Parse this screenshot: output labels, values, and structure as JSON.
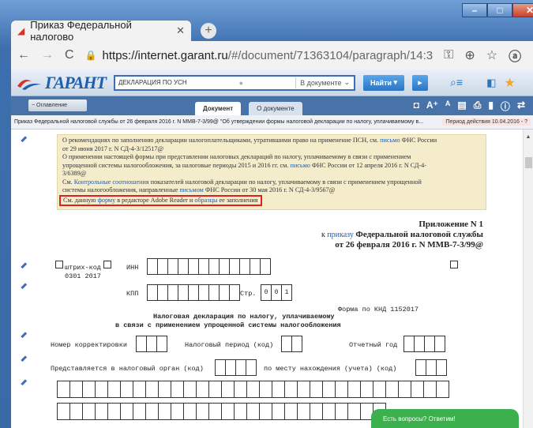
{
  "browser": {
    "tab_title": "Приказ Федеральной налогово",
    "url_host": "https://internet.garant.ru",
    "url_path": "/#/document/71363104/paragraph/14:3"
  },
  "garant": {
    "logo": "ГАРАНТ",
    "search_value": "ДЕКЛАРАЦИЯ ПО УСН",
    "search_scope": "В документе",
    "find_label": "Найти",
    "sidebar_label": "Оглавление",
    "tab_document": "Документ",
    "tab_about": "О документе"
  },
  "crumb": {
    "text": "Приказ Федеральной налоговой службы от 26 февраля 2016 г. N ММВ-7-3/99@ \"Об утверждении формы налоговой декларации по налогу, уплачиваемому в...",
    "period": "Период действия 10.04.2016 - ?"
  },
  "note": {
    "l1": "О рекомендациях по заполнению декларации налогоплательщиками, утратившими право на применение ПСН, см.",
    "l1_link": "письмо",
    "l1_end": "ФНС России",
    "l2": "от 29 июня 2017 г. N СД-4-3/12517@",
    "l3": "О применении настоящей формы при представлении налоговых деклараций по налогу, уплачиваемому в связи с применением",
    "l4a": "упрощенной системы налогообложения, за налоговые периоды 2015 и 2016 гг. см.",
    "l4_link": "письмо",
    "l4b": "ФНС России от 12 апреля 2016 г. N СД-4-",
    "l5": "3/6389@",
    "l6a": "См.",
    "l6_link": "Контрольные соотношения",
    "l6b": "показателей налоговой декларации по налогу, уплачиваемому в связи с применением упрощенной",
    "l7a": "системы налогообложения, направленные",
    "l7_link": "письмом",
    "l7b": "ФНС России от 30 мая 2016 г. N СД-4-3/9567@",
    "l8a": "См. данную",
    "l8_link1": "форму",
    "l8b": "в редакторе Adobe Reader и",
    "l8_link2": "образцы",
    "l8c": "ее заполнения"
  },
  "appendix": {
    "title": "Приложение N 1",
    "l2a": "к",
    "l2_link": "приказу",
    "l2b": "Федеральной налоговой службы",
    "l3": "от 26 февраля 2016 г. N ММВ-7-3/99@"
  },
  "form": {
    "barcode": "штрих-код",
    "barcode_num": "0301 2017",
    "inn": "ИНН",
    "kpp": "КПП",
    "page": "Стр.",
    "page_digits": [
      "0",
      "0",
      "1"
    ],
    "knd": "Форма по КНД 1152017",
    "title1": "Налоговая декларация по налогу, уплачиваемому",
    "title2": "в связи с применением упрощенной системы налогообложения",
    "correction": "Номер корректировки",
    "period": "Налоговый период (код)",
    "year": "Отчетный год",
    "organ": "Представляется в налоговый орган (код)",
    "location": "по месту нахождения (учета) (код)"
  },
  "chat": "Есть вопросы? Ответим!"
}
